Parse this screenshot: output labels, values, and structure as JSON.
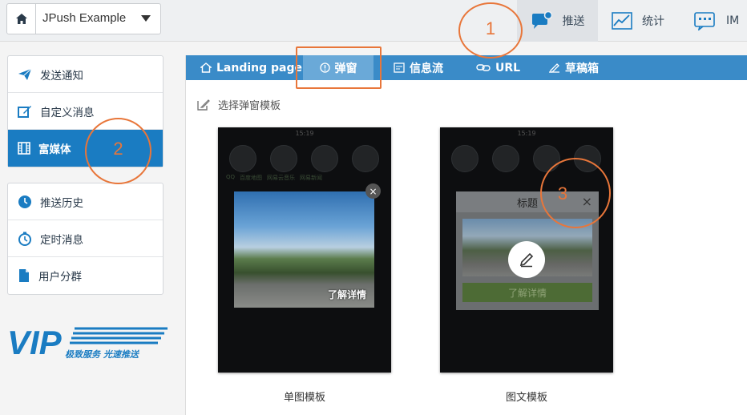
{
  "app": {
    "name": "JPush Example"
  },
  "topnav": [
    {
      "label": "推送",
      "icon": "chat-bubble-icon"
    },
    {
      "label": "统计",
      "icon": "line-chart-icon"
    },
    {
      "label": "IM",
      "icon": "im-chat-icon"
    }
  ],
  "sidebar": {
    "group1": [
      {
        "label": "发送通知",
        "icon": "paper-plane-icon"
      },
      {
        "label": "自定义消息",
        "icon": "edit-icon"
      },
      {
        "label": "富媒体",
        "icon": "film-icon",
        "active": true
      }
    ],
    "group2": [
      {
        "label": "推送历史",
        "icon": "history-icon"
      },
      {
        "label": "定时消息",
        "icon": "timer-icon"
      },
      {
        "label": "用户分群",
        "icon": "document-icon"
      }
    ]
  },
  "vip": {
    "mark": "VIP",
    "slogan": "极致服务 光速推送"
  },
  "tabs": [
    {
      "label": "Landing page",
      "icon": "home-icon"
    },
    {
      "label": "弹窗",
      "icon": "alert-icon",
      "active": true
    },
    {
      "label": "信息流",
      "icon": "feed-icon"
    },
    {
      "label": "URL",
      "icon": "link-icon"
    },
    {
      "label": "草稿箱",
      "icon": "drafts-icon"
    }
  ],
  "template_section": {
    "label": "选择弹窗模板"
  },
  "phone_ui": {
    "time": "15:19",
    "app_labels": [
      "QQ",
      "百度地图",
      "网易云音乐",
      "网易新闻"
    ]
  },
  "templates": [
    {
      "caption": "单图模板",
      "button": "了解详情",
      "close": "×"
    },
    {
      "caption": "图文模板",
      "title": "标题",
      "button": "了解详情",
      "close": "×"
    }
  ],
  "annotations": [
    "1",
    "2",
    "3"
  ],
  "colors": {
    "accent": "#1a7cc2",
    "tabbar": "#3a8bc8",
    "annotation": "#e8763a"
  }
}
